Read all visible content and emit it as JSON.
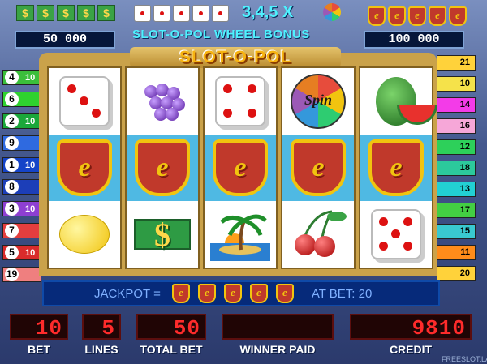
{
  "top": {
    "left_icons": [
      "$",
      "$",
      "$",
      "$",
      "$"
    ],
    "dice_icons": 5,
    "bonus_mult": "3,4,5 X",
    "bonus_title": "SLOT-O-POL WHEEL BONUS",
    "right_icons": [
      "e",
      "e",
      "e",
      "e",
      "e"
    ],
    "left_score": "50 000",
    "right_score": "100 000"
  },
  "logo": "SLOT-O-POL",
  "left_lines": [
    {
      "num": "4",
      "bet": "10",
      "color": "#3bbf3b"
    },
    {
      "num": "6",
      "bet": "",
      "color": "#2fd22f"
    },
    {
      "num": "2",
      "bet": "10",
      "color": "#1ba73a"
    },
    {
      "num": "9",
      "bet": "",
      "color": "#2f6ae0"
    },
    {
      "num": "1",
      "bet": "10",
      "color": "#1544c8"
    },
    {
      "num": "8",
      "bet": "",
      "color": "#1c3eb8"
    },
    {
      "num": "3",
      "bet": "10",
      "color": "#8e3fd2"
    },
    {
      "num": "7",
      "bet": "",
      "color": "#e43e3e"
    },
    {
      "num": "5",
      "bet": "10",
      "color": "#d92b2b"
    },
    {
      "num": "19",
      "bet": "",
      "color": "#ef7f7f"
    }
  ],
  "right_lines": [
    {
      "num": "21",
      "color": "#ffd23a"
    },
    {
      "num": "10",
      "color": "#f5e24a"
    },
    {
      "num": "14",
      "color": "#f33be8"
    },
    {
      "num": "16",
      "color": "#f6a7d8"
    },
    {
      "num": "12",
      "color": "#2dd05a"
    },
    {
      "num": "18",
      "color": "#2cc99c"
    },
    {
      "num": "13",
      "color": "#22d0d3"
    },
    {
      "num": "17",
      "color": "#43cf43"
    },
    {
      "num": "15",
      "color": "#39c9d0"
    },
    {
      "num": "11",
      "color": "#ff8c1a"
    },
    {
      "num": "20",
      "color": "#ffd23a"
    }
  ],
  "reels": [
    [
      "dice",
      "shield",
      "lemon"
    ],
    [
      "grapes",
      "shield",
      "dollar"
    ],
    [
      "dice",
      "shield",
      "island"
    ],
    [
      "spin-wheel",
      "shield",
      "cherries"
    ],
    [
      "watermelon",
      "shield",
      "dice"
    ]
  ],
  "spin_text": "Spin",
  "jackpot": {
    "label": "JACKPOT =",
    "bet_text": "AT BET: 20",
    "icon_count": 5
  },
  "displays": [
    {
      "label": "BET",
      "value": "10"
    },
    {
      "label": "LINES",
      "value": "5"
    },
    {
      "label": "TOTAL BET",
      "value": "50"
    },
    {
      "label": "WINNER PAID",
      "value": ""
    },
    {
      "label": "CREDIT",
      "value": "9810"
    }
  ],
  "watermark": "FREESLOT.LA",
  "colors": {
    "reel_mid": "#4fb9e3",
    "display_red": "#ff2b2b",
    "bonus_cyan": "#4ff1ff"
  }
}
